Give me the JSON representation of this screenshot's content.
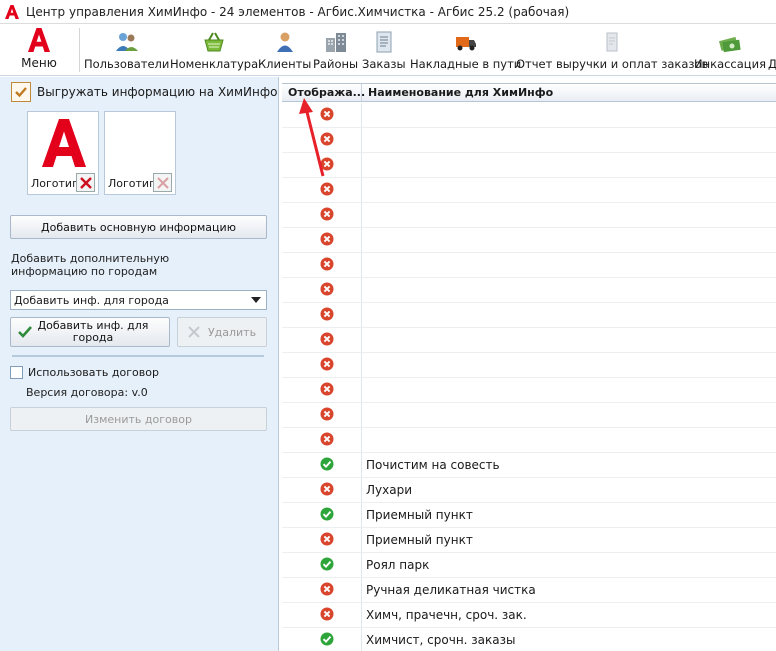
{
  "window": {
    "title": "Центр управления ХимИнфо - 24 элементов - Агбис.Химчистка - Агбис 25.2 (рабочая)"
  },
  "toolbar": {
    "menu_label": "Меню",
    "items": [
      {
        "label": "Пользователи",
        "icon": "users-icon"
      },
      {
        "label": "Номенклатура",
        "icon": "basket-icon"
      },
      {
        "label": "Клиенты",
        "icon": "client-icon"
      },
      {
        "label": "Районы",
        "icon": "buildings-icon"
      },
      {
        "label": "Заказы",
        "icon": "document-icon"
      },
      {
        "label": "Накладные в пути",
        "icon": "truck-icon"
      },
      {
        "label": "Отчет выручки и оплат заказов",
        "icon": "report-icon"
      },
      {
        "label": "Инкассация",
        "icon": "money-icon"
      },
      {
        "label": "Д",
        "icon": ""
      }
    ]
  },
  "left_panel": {
    "export_checkbox_label": "Выгружать информацию на ХимИнфо",
    "export_checked": true,
    "logo1_label": "Логотип",
    "logo2_label": "Логотип",
    "add_main_info_button": "Добавить основную информацию",
    "add_city_info_text": "Добавить дополнительную информацию по городам",
    "city_select_value": "Добавить инф. для города",
    "add_city_button": "Добавить инф. для города",
    "delete_button": "Удалить",
    "use_contract_label": "Использовать договор",
    "use_contract_checked": false,
    "contract_version": "Версия договора: v.0",
    "change_contract_button": "Изменить договор"
  },
  "grid": {
    "columns": [
      "Отобража...",
      "Наименование для ХимИнфо"
    ],
    "rows": [
      {
        "status": "no",
        "name": ""
      },
      {
        "status": "no",
        "name": ""
      },
      {
        "status": "no",
        "name": ""
      },
      {
        "status": "no",
        "name": ""
      },
      {
        "status": "no",
        "name": ""
      },
      {
        "status": "no",
        "name": ""
      },
      {
        "status": "no",
        "name": ""
      },
      {
        "status": "no",
        "name": ""
      },
      {
        "status": "no",
        "name": ""
      },
      {
        "status": "no",
        "name": ""
      },
      {
        "status": "no",
        "name": ""
      },
      {
        "status": "no",
        "name": ""
      },
      {
        "status": "no",
        "name": ""
      },
      {
        "status": "no",
        "name": ""
      },
      {
        "status": "yes",
        "name": "Почистим на совесть"
      },
      {
        "status": "no",
        "name": "Лухари"
      },
      {
        "status": "yes",
        "name": "Приемный пункт"
      },
      {
        "status": "no",
        "name": "Приемный пункт"
      },
      {
        "status": "yes",
        "name": "Роял парк"
      },
      {
        "status": "no",
        "name": "Ручная деликатная чистка"
      },
      {
        "status": "no",
        "name": "Химч, прачечн, сроч. зак."
      },
      {
        "status": "yes",
        "name": "Химчист, срочн. заказы"
      }
    ]
  },
  "colors": {
    "brand_red": "#e3001b",
    "status_yes": "#2ea53a",
    "status_no": "#d9452c",
    "annotation_arrow": "#e8202a"
  }
}
